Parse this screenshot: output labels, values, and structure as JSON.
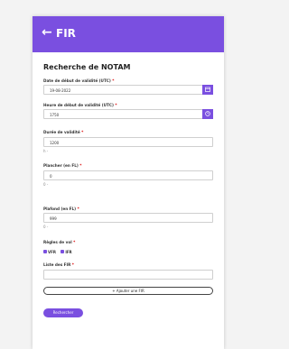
{
  "app": {
    "title": "FIR",
    "back": "←"
  },
  "page": {
    "title": "Recherche de NOTAM"
  },
  "fields": {
    "date_label": "Date de début de validité (UTC)",
    "date_value": "19-08-2022",
    "time_label": "Heure de début de validité (UTC)",
    "time_value": "1750",
    "duration_label": "Durée de validité",
    "duration_value": "1200",
    "duration_helper": "h -",
    "floor_label": "Plancher (en FL)",
    "floor_value": "0",
    "floor_helper": "0 -",
    "ceiling_label": "Plafond (en FL)",
    "ceiling_value": "999",
    "ceiling_helper": "0 -",
    "fir_label": "Liste des FIR",
    "fir_value": ""
  },
  "rules": {
    "label": "Règles de vol",
    "vfr": "VFR",
    "ifr": "IFR"
  },
  "required_mark": "*",
  "buttons": {
    "add_fir": "+ Ajouter une FIR",
    "search": "Rechercher"
  },
  "icons": {
    "calendar": "calendar-icon",
    "clock": "clock-icon"
  },
  "colors": {
    "accent": "#7a4fe0"
  }
}
